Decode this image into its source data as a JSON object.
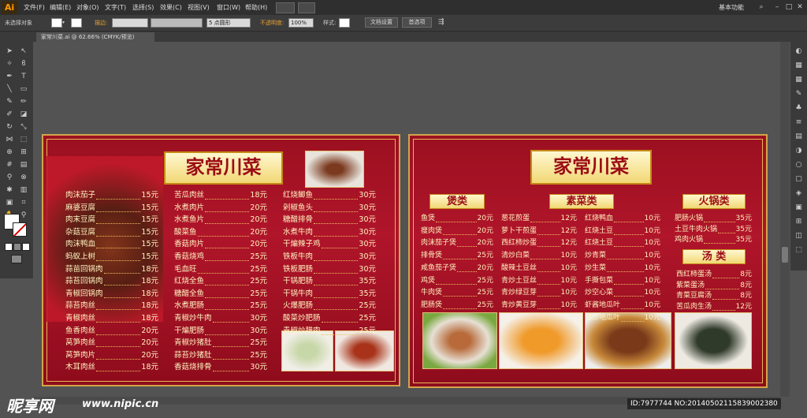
{
  "app": {
    "logo": "Ai",
    "menus": [
      "文件(F)",
      "编辑(E)",
      "对象(O)",
      "文字(T)",
      "选择(S)",
      "效果(C)",
      "视图(V)",
      "窗口(W)",
      "帮助(H)"
    ],
    "workspace": "基本功能"
  },
  "control_bar": {
    "no_selection": "未选择对象",
    "stroke_label": "描边:",
    "brush": "5 点圆形",
    "opacity_label": "不透明度:",
    "opacity_value": "100%",
    "style_label": "样式:",
    "doc_setup": "文档设置",
    "preferences": "首选项"
  },
  "document": {
    "tab_title": "家常川菜.ai @ 62.66% (CMYK/预览)"
  },
  "left_board": {
    "title": "家常川菜",
    "col1": [
      {
        "name": "肉沫茄子",
        "price": "15元"
      },
      {
        "name": "麻婆豆腐",
        "price": "15元"
      },
      {
        "name": "肉末豆腐",
        "price": "15元"
      },
      {
        "name": "杂菇豆腐",
        "price": "15元"
      },
      {
        "name": "肉沫鸭血",
        "price": "15元"
      },
      {
        "name": "蚂蚁上树",
        "price": "15元"
      },
      {
        "name": "蒜苗回锅肉",
        "price": "18元"
      },
      {
        "name": "蒜苔回锅肉",
        "price": "18元"
      },
      {
        "name": "青椒回锅肉",
        "price": "18元"
      },
      {
        "name": "蒜苔肉丝",
        "price": "18元"
      },
      {
        "name": "青椒肉丝",
        "price": "18元"
      },
      {
        "name": "鱼香肉丝",
        "price": "20元"
      },
      {
        "name": "莴笋肉丝",
        "price": "20元"
      },
      {
        "name": "莴笋肉片",
        "price": "20元"
      },
      {
        "name": "木耳肉丝",
        "price": "18元"
      }
    ],
    "col2": [
      {
        "name": "苦瓜肉丝",
        "price": "18元"
      },
      {
        "name": "水煮肉片",
        "price": "20元"
      },
      {
        "name": "水煮鱼片",
        "price": "20元"
      },
      {
        "name": "酸菜鱼",
        "price": "20元"
      },
      {
        "name": "香菇肉片",
        "price": "20元"
      },
      {
        "name": "香菇烧鸡",
        "price": "25元"
      },
      {
        "name": "毛血旺",
        "price": "25元"
      },
      {
        "name": "红烧全鱼",
        "price": "25元"
      },
      {
        "name": "糖醋全鱼",
        "price": "25元"
      },
      {
        "name": "水煮肥肠",
        "price": "25元"
      },
      {
        "name": "青椒炒牛肉",
        "price": "30元"
      },
      {
        "name": "干煸肥肠",
        "price": "30元"
      },
      {
        "name": "青椒炒猪肚",
        "price": "25元"
      },
      {
        "name": "蒜苔炒猪肚",
        "price": "25元"
      },
      {
        "name": "香菇烧排骨",
        "price": "30元"
      }
    ],
    "col3": [
      {
        "name": "红烧鲫鱼",
        "price": "30元"
      },
      {
        "name": "剁椒鱼头",
        "price": "30元"
      },
      {
        "name": "糖醋排骨",
        "price": "30元"
      },
      {
        "name": "水煮牛肉",
        "price": "30元"
      },
      {
        "name": "干煸辣子鸡",
        "price": "30元"
      },
      {
        "name": "铁板牛肉",
        "price": "30元"
      },
      {
        "name": "铁板肥肠",
        "price": "30元"
      },
      {
        "name": "干锅肥肠",
        "price": "35元"
      },
      {
        "name": "干锅牛肉",
        "price": "35元"
      },
      {
        "name": "火爆肥肠",
        "price": "25元"
      },
      {
        "name": "酸菜炒肥肠",
        "price": "25元"
      },
      {
        "name": "青椒炒腊肉",
        "price": "25元"
      }
    ]
  },
  "right_board": {
    "title": "家常川菜",
    "cat1": "煲类",
    "cat2": "素菜类",
    "cat3": "火锅类",
    "cat4": "汤 类",
    "bao": [
      {
        "name": "鱼煲",
        "price": "20元"
      },
      {
        "name": "瘦肉煲",
        "price": "20元"
      },
      {
        "name": "肉沫茄子煲",
        "price": "20元"
      },
      {
        "name": "排骨煲",
        "price": "25元"
      },
      {
        "name": "咸鱼茄子煲",
        "price": "20元"
      },
      {
        "name": "鸡煲",
        "price": "25元"
      },
      {
        "name": "牛肉煲",
        "price": "25元"
      },
      {
        "name": "肥肠煲",
        "price": "25元"
      }
    ],
    "su1": [
      {
        "name": "葱花煎蛋",
        "price": "12元"
      },
      {
        "name": "萝卜干煎蛋",
        "price": "12元"
      },
      {
        "name": "西红柿炒蛋",
        "price": "12元"
      },
      {
        "name": "清炒白菜",
        "price": "10元"
      },
      {
        "name": "酸辣土豆丝",
        "price": "10元"
      },
      {
        "name": "青炒土豆丝",
        "price": "10元"
      },
      {
        "name": "青炒绿豆芽",
        "price": "10元"
      },
      {
        "name": "青炒黄豆芽",
        "price": "10元"
      }
    ],
    "su2": [
      {
        "name": "红烧鸭血",
        "price": "10元"
      },
      {
        "name": "红烧土豆",
        "price": "10元"
      },
      {
        "name": "红烧土豆",
        "price": "10元"
      },
      {
        "name": "炒青菜",
        "price": "10元"
      },
      {
        "name": "炒生菜",
        "price": "10元"
      },
      {
        "name": "手撕包菜",
        "price": "10元"
      },
      {
        "name": "炒空心菜",
        "price": "10元"
      },
      {
        "name": "虾酱地瓜叶",
        "price": "10元"
      },
      {
        "name": "清炒地瓜叶",
        "price": "10元"
      }
    ],
    "hotpot": [
      {
        "name": "肥肠火锅",
        "price": "35元"
      },
      {
        "name": "土豆牛肉火锅",
        "price": "35元"
      },
      {
        "name": "鸡肉火锅",
        "price": "35元"
      }
    ],
    "soup": [
      {
        "name": "西红柿蛋汤",
        "price": "8元"
      },
      {
        "name": "紫菜蛋汤",
        "price": "8元"
      },
      {
        "name": "青菜豆腐汤",
        "price": "8元"
      },
      {
        "name": "苦瓜肉生汤",
        "price": "12元"
      }
    ]
  },
  "watermark": {
    "brand": "昵享网",
    "url": "www.nipic.cn",
    "id": "ID:7977744 NO:20140502115839002380"
  },
  "colors": {
    "board_red": "#a51224",
    "gold": "#e5b65a",
    "ai_orange": "#ff9a00"
  }
}
